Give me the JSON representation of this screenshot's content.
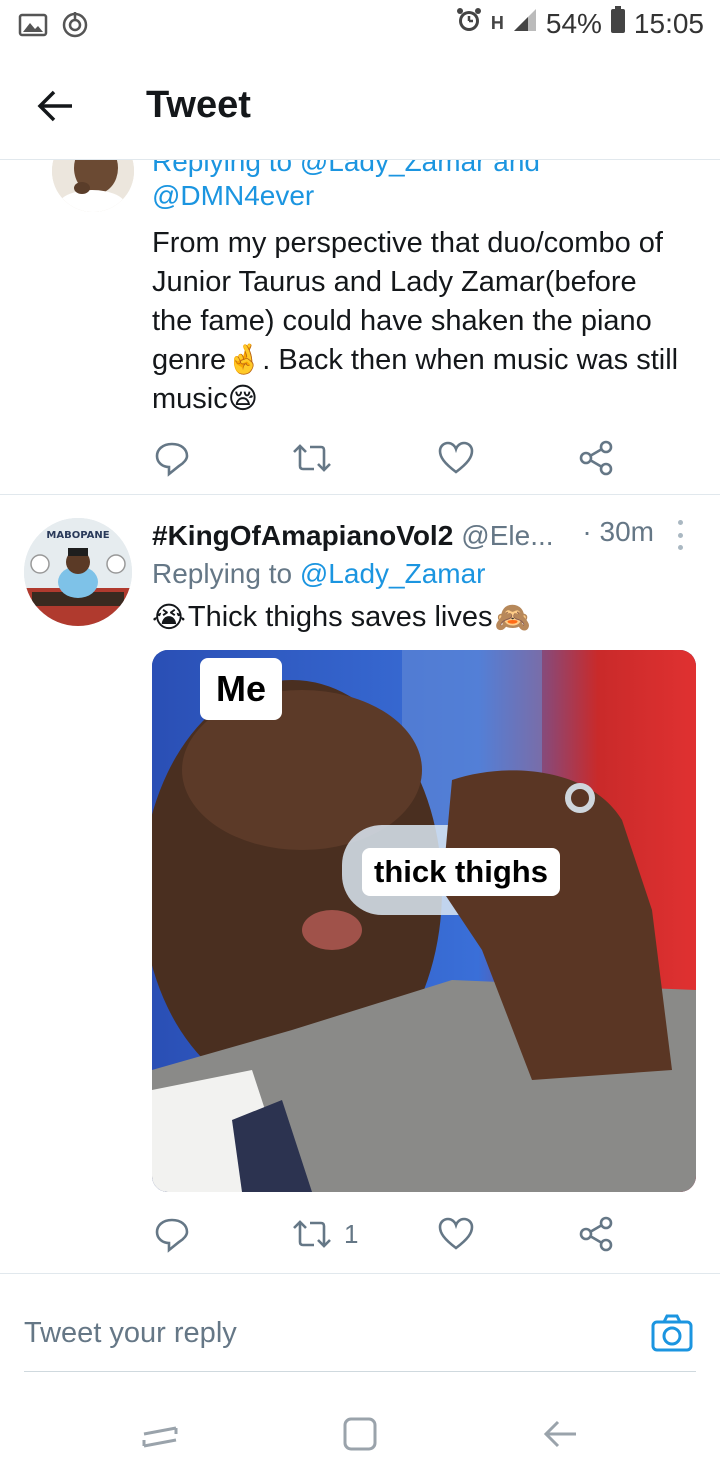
{
  "status_bar": {
    "signal_label": "H",
    "battery_percent": "54%",
    "time": "15:05"
  },
  "header": {
    "title": "Tweet"
  },
  "tweet1": {
    "replying_partial": "Replying to @Lady_Zamar and",
    "reply_handle": "@DMN4ever",
    "text_line1": "From my perspective that duo/combo of",
    "text_line2": "Junior Taurus and Lady Zamar(before",
    "text_line3": "the fame) could have shaken the piano",
    "text_line4_a": "genre",
    "text_line4_emoji": "🤞",
    "text_line4_b": ". Back then when music was still",
    "text_line5_a": "music",
    "text_line5_emoji": "😪"
  },
  "tweet2": {
    "avatar_text": "MABOPANE",
    "name": "#KingOfAmapianoVol2",
    "handle": "@Ele...",
    "time": "· 30m",
    "replying_prefix": "Replying to ",
    "replying_mention": "@Lady_Zamar",
    "text_emoji_start": "😭",
    "text": "Thick thighs saves lives",
    "text_emoji_end": "🙈",
    "media": {
      "label_top": "Me",
      "label_bottle": "thick thighs"
    },
    "retweet_count": "1"
  },
  "composer": {
    "placeholder": "Tweet your reply"
  },
  "colors": {
    "link_blue": "#1b95e0",
    "secondary_text": "#657786",
    "divider": "#e1e8ed"
  }
}
